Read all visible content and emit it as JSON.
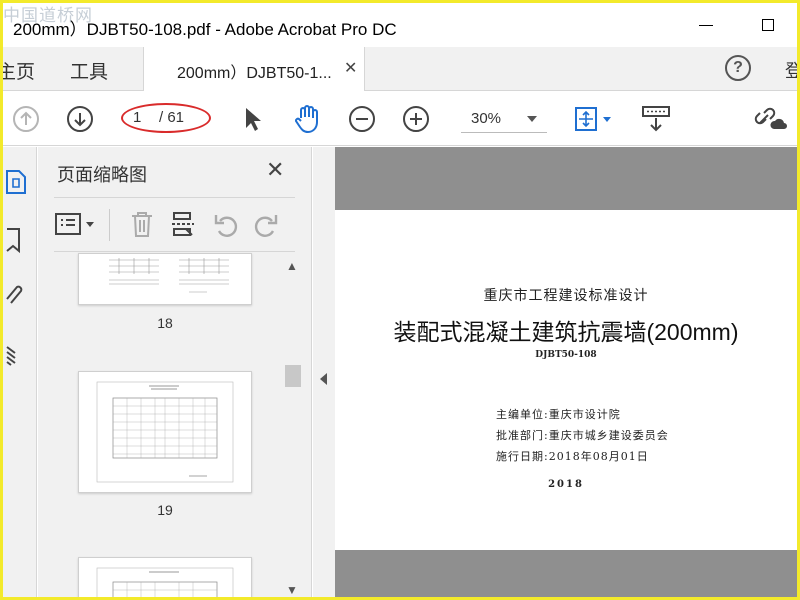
{
  "window": {
    "title": "200mm）DJBT50-108.pdf - Adobe Acrobat Pro DC",
    "watermark": "中国道桥网"
  },
  "tabs": {
    "home": "主页",
    "tools": "工具",
    "document": "200mm）DJBT50-1...",
    "login": "登"
  },
  "toolbar": {
    "current_page": "1",
    "total_pages": "/ 61",
    "zoom": "30%",
    "annotation_color": "#d92b2b"
  },
  "thumbnails": {
    "title": "页面缩略图",
    "items": [
      {
        "label": "18"
      },
      {
        "label": "19"
      },
      {
        "label": ""
      }
    ]
  },
  "document_page": {
    "org": "重庆市工程建设标准设计",
    "title": "装配式混凝土建筑抗震墙(200mm)",
    "code": "DJBT50-108",
    "editor": "主编单位:重庆市设计院",
    "approver": "批准部门:重庆市城乡建设委员会",
    "date": "施行日期:2018年08月01日",
    "year": "2018"
  },
  "colors": {
    "accent_blue": "#1f6fd1",
    "highlight_border": "#f3ea2b",
    "doc_background": "#8f8f8f"
  }
}
